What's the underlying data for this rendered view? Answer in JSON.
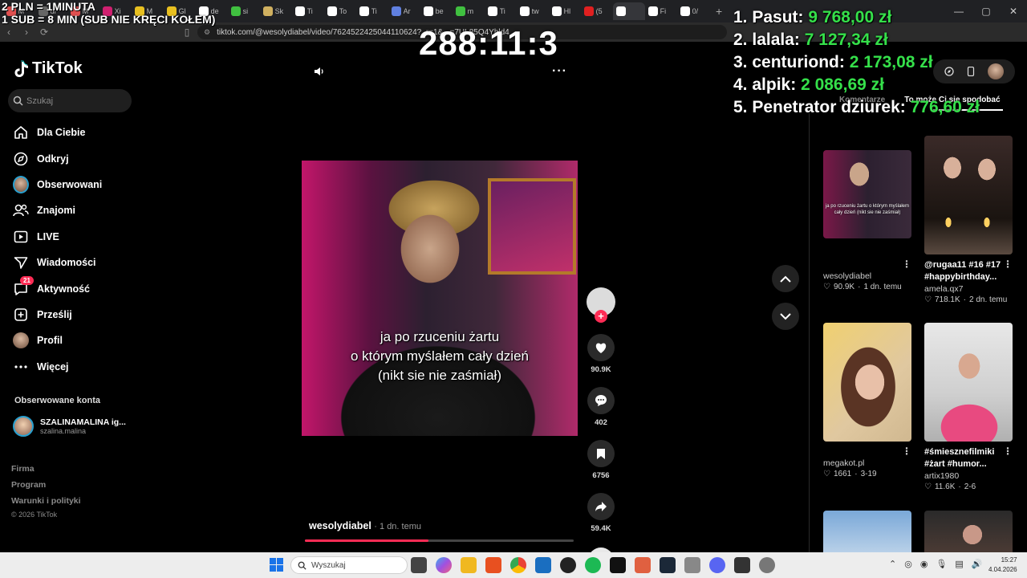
{
  "overlay": {
    "rate_line1": "2 PLN = 1MINUTA",
    "rate_line2": "1 SUB = 8 MIN (SUB NIE KRĘCI KOŁEM)",
    "timer": "288:11:3",
    "leaderboard": [
      {
        "rank": "1.",
        "name": "Pasut:",
        "amount": "9 768,00 zł"
      },
      {
        "rank": "2.",
        "name": "lalala:",
        "amount": "7 127,34 zł"
      },
      {
        "rank": "3.",
        "name": "centuriond:",
        "amount": "2 173,08 zł"
      },
      {
        "rank": "4.",
        "name": "alpik:",
        "amount": "2 086,69 zł"
      },
      {
        "rank": "5.",
        "name": "Penetrator dziurek:",
        "amount": "776,60 zł"
      }
    ]
  },
  "browser": {
    "url": "tiktok.com/@wesolydiabel/video/7624522425044110624?_r=1&...=7UL85Q4Yhld4",
    "tabs": [
      {
        "label": "M",
        "color": "#e05050"
      },
      {
        "label": "ul",
        "color": "#666666"
      },
      {
        "label": "M",
        "color": "#e05050"
      },
      {
        "label": "Xi",
        "color": "#d02070"
      },
      {
        "label": "M",
        "color": "#e8c020"
      },
      {
        "label": "Gl",
        "color": "#e8c020"
      },
      {
        "label": "de",
        "color": "#ffffff"
      },
      {
        "label": "si",
        "color": "#40c040"
      },
      {
        "label": "Sk",
        "color": "#d0b060"
      },
      {
        "label": "Ti",
        "color": "#ffffff"
      },
      {
        "label": "To",
        "color": "#ffffff"
      },
      {
        "label": "Ti",
        "color": "#ffffff"
      },
      {
        "label": "Ar",
        "color": "#6080e0"
      },
      {
        "label": "be",
        "color": "#ffffff"
      },
      {
        "label": "m",
        "color": "#40c040"
      },
      {
        "label": "Ti",
        "color": "#ffffff"
      },
      {
        "label": "tw",
        "color": "#ffffff"
      },
      {
        "label": "Hl",
        "color": "#ffffff"
      },
      {
        "label": "(5",
        "color": "#e02020"
      },
      {
        "label": "",
        "color": "#ffffff"
      },
      {
        "label": "Fi",
        "color": "#ffffff"
      },
      {
        "label": "0/",
        "color": "#ffffff"
      }
    ]
  },
  "sidebar": {
    "logo": "TikTok",
    "search_placeholder": "Szukaj",
    "items": [
      {
        "label": "Dla Ciebie",
        "icon": "home-icon"
      },
      {
        "label": "Odkryj",
        "icon": "compass-icon"
      },
      {
        "label": "Obserwowani",
        "icon": "avatar-icon"
      },
      {
        "label": "Znajomi",
        "icon": "friends-icon"
      },
      {
        "label": "LIVE",
        "icon": "live-icon"
      },
      {
        "label": "Wiadomości",
        "icon": "send-icon"
      },
      {
        "label": "Aktywność",
        "icon": "activity-icon",
        "badge": "21"
      },
      {
        "label": "Prześlij",
        "icon": "upload-icon"
      },
      {
        "label": "Profil",
        "icon": "profile-icon"
      },
      {
        "label": "Więcej",
        "icon": "more-icon"
      }
    ],
    "followed_title": "Obserwowane konta",
    "followed": {
      "name": "SZALINAMALINA ig...",
      "handle": "szalina.malina"
    },
    "footer": [
      "Firma",
      "Program",
      "Warunki i polityki"
    ],
    "copyright": "© 2026 TikTok"
  },
  "video": {
    "caption_lines": [
      "ja po rzuceniu żartu",
      "o którym myślałem cały dzień",
      "(nikt sie nie zaśmiał)"
    ],
    "author": "wesolydiabel",
    "time": "· 1 dn. temu",
    "progress": 0.46,
    "likes": "90.9K",
    "comments": "402",
    "saves": "6756",
    "shares": "59.4K"
  },
  "right_panel": {
    "tabs": [
      "Komentarze",
      "To może Ci się spodobać"
    ],
    "cards": [
      {
        "title": "",
        "user": "wesolydiabel",
        "likes": "90.9K",
        "time": "1 dn. temu",
        "thumb_caption": "ja po rzuceniu żartu o którym myślałem cały dzień (nikt sie nie zaśmiał)"
      },
      {
        "title": "@rugaa11 #16 #17 #happybirthday...",
        "user": "amela.qx7",
        "likes": "718.1K",
        "time": "2 dn. temu",
        "thumb_caption": ""
      },
      {
        "title": "",
        "user": "megakot.pl",
        "likes": "1661",
        "time": "3-19",
        "thumb_caption": ""
      },
      {
        "title": "#śmiesznefilmiki #żart #humor...",
        "user": "artix1980",
        "likes": "11.6K",
        "time": "2-6",
        "thumb_caption": ""
      }
    ]
  },
  "taskbar": {
    "search_placeholder": "Wyszukaj",
    "time": "15:27",
    "date": "4.04.2026"
  }
}
